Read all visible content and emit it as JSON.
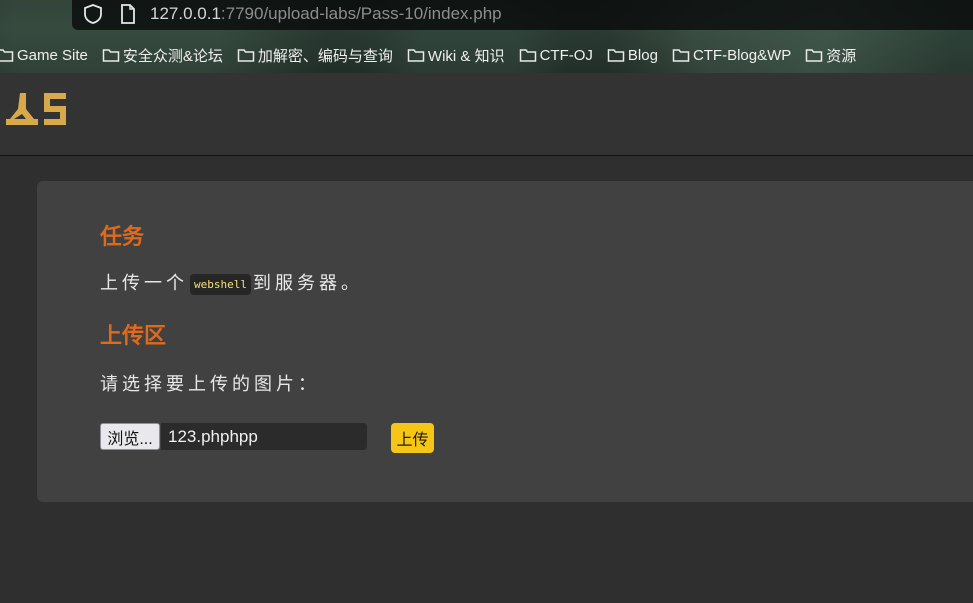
{
  "browser": {
    "url_host": "127.0.0.1",
    "url_rest": ":7790/upload-labs/Pass-10/index.php",
    "bookmarks": [
      "Game Site",
      "安全众测&论坛",
      "加解密、编码与查询",
      "Wiki & 知识",
      "CTF-OJ",
      "Blog",
      "CTF-Blog&WP",
      "资源"
    ]
  },
  "colors": {
    "accent_heading": "#e06a1b",
    "upload_button": "#f6c515",
    "logo": "#d8a94a"
  },
  "task": {
    "heading": "任务",
    "text_before": "上传一个",
    "code": "webshell",
    "text_after": "到服务器。"
  },
  "upload": {
    "heading": "上传区",
    "prompt": "请选择要上传的图片：",
    "browse_label": "浏览...",
    "file_name": "123.phphpp",
    "submit_label": "上传"
  }
}
